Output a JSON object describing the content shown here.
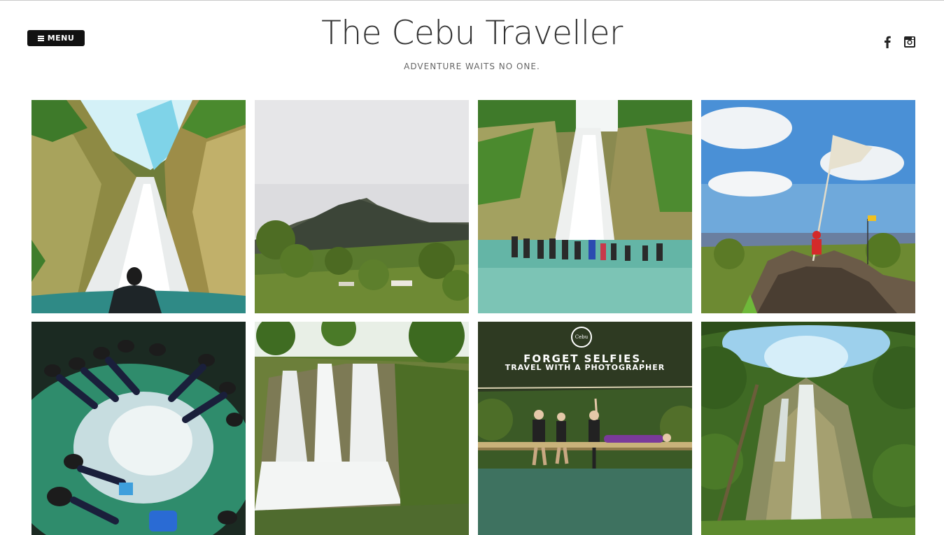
{
  "header": {
    "menu_label": "MENU",
    "site_title": "The Cebu Traveller",
    "tagline": "ADVENTURE WAITS NO ONE."
  },
  "social": [
    {
      "icon": "facebook-icon"
    },
    {
      "icon": "instagram-icon"
    }
  ],
  "gallery": {
    "tiles": [
      {
        "scene": "waterfall-canyon-person"
      },
      {
        "scene": "misty-mountain"
      },
      {
        "scene": "waterfall-group-in-water"
      },
      {
        "scene": "rock-peak-flag"
      },
      {
        "scene": "people-floating-cave"
      },
      {
        "scene": "cascading-falls"
      },
      {
        "scene": "bamboo-bridge-poster",
        "overlay_line1": "FORGET SELFIES.",
        "overlay_line2": "TRAVEL WITH A PHOTOGRAPHER",
        "badge_text": "Cebu"
      },
      {
        "scene": "mossy-falls-forest"
      }
    ]
  }
}
